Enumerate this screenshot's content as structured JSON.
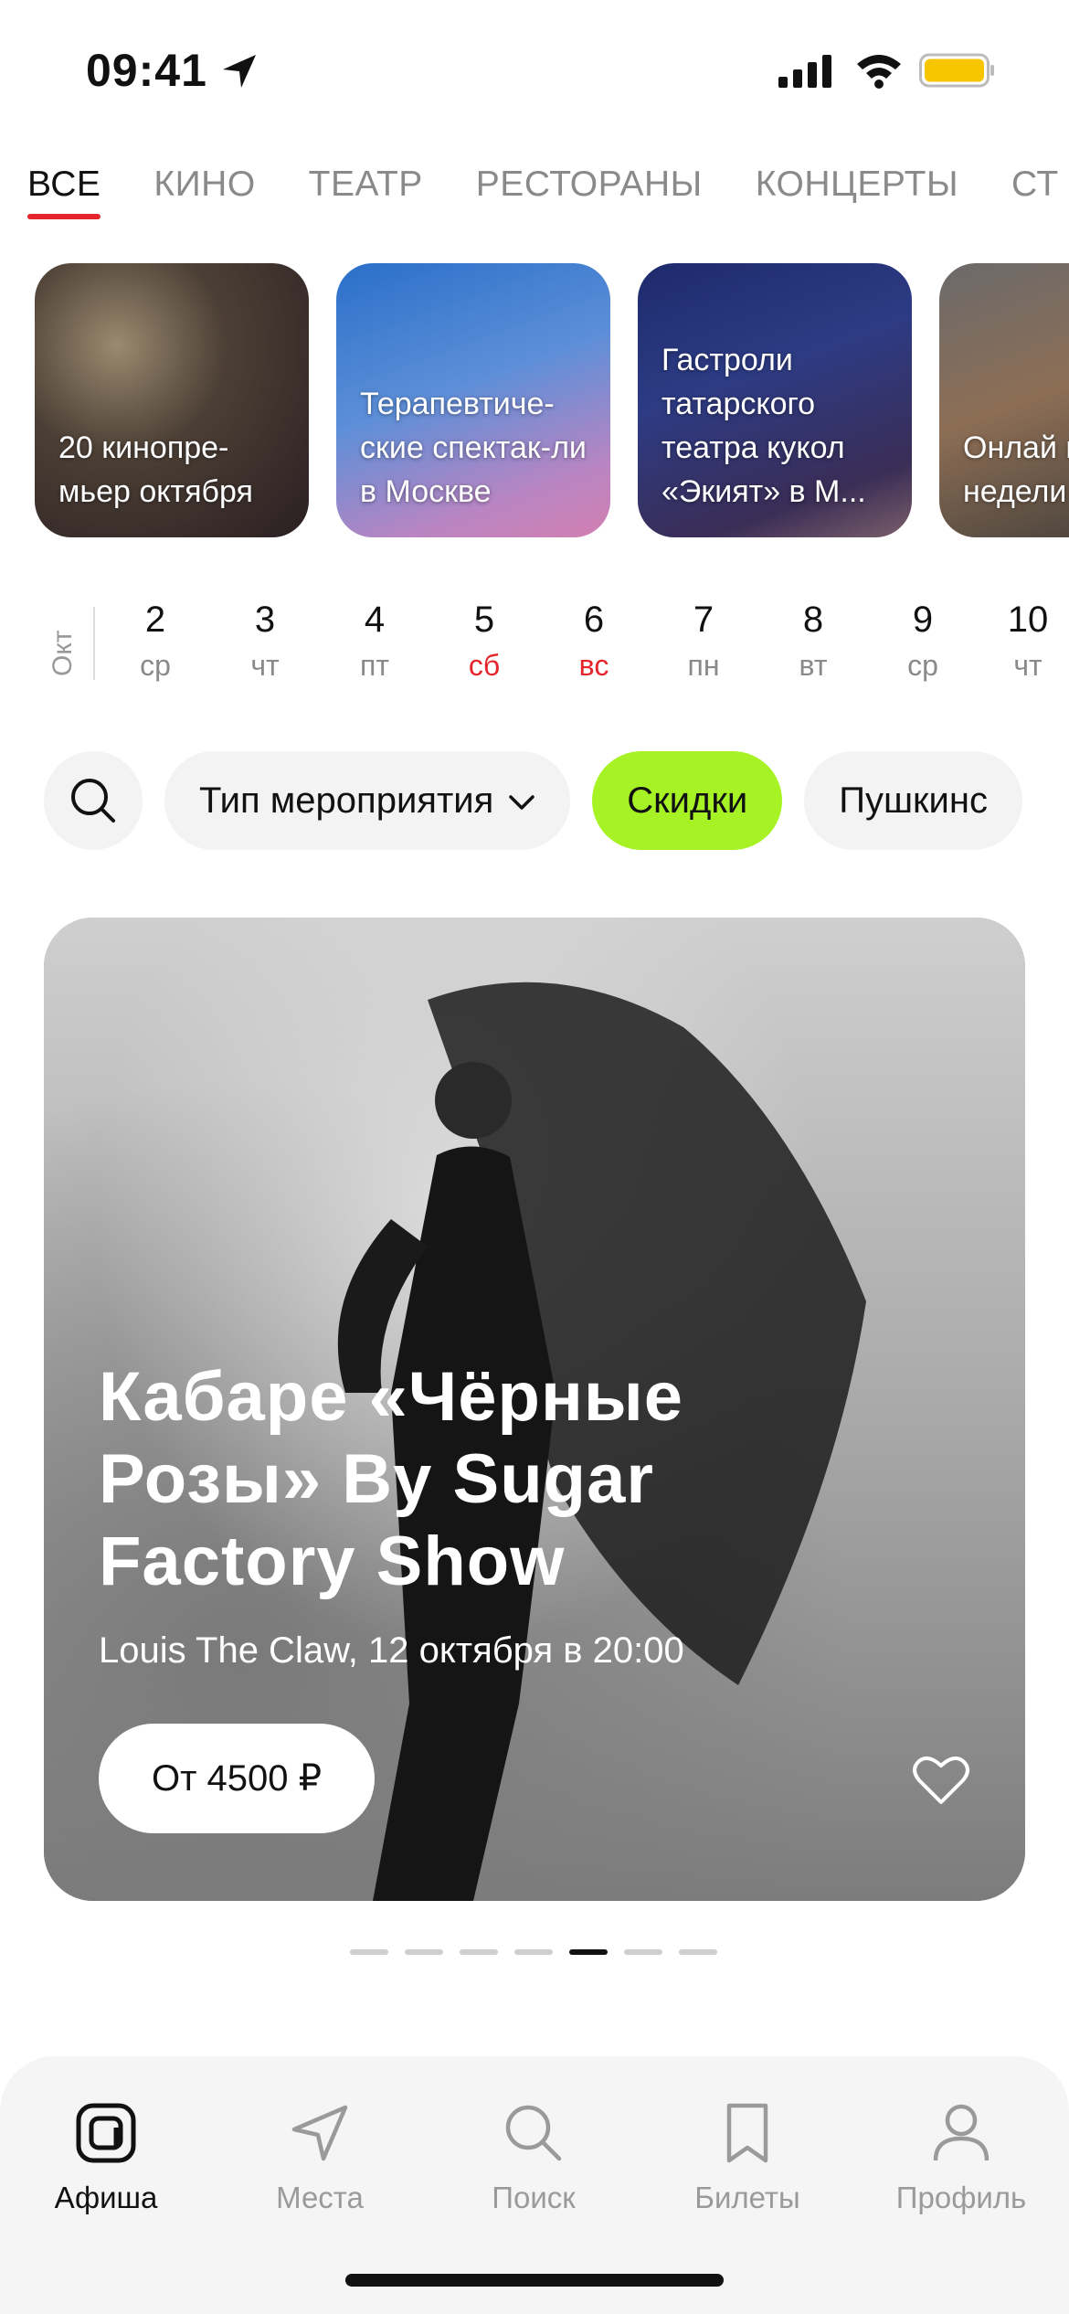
{
  "status_bar": {
    "time": "09:41",
    "icons": [
      "location-arrow-icon",
      "cellular-signal-icon",
      "wifi-icon",
      "battery-icon"
    ],
    "battery_color": "#f7c600"
  },
  "tabs": [
    "ВСЕ",
    "КИНО",
    "ТЕАТР",
    "РЕСТОРАНЫ",
    "КОНЦЕРТЫ",
    "СТ"
  ],
  "active_tab": "ВСЕ",
  "stories": [
    {
      "text": "20 кинопре-мьер октября"
    },
    {
      "text": "Терапевтиче-ские спектак-ли в Москве"
    },
    {
      "text": "Гастроли татарского театра кукол «Экият» в М..."
    },
    {
      "text": "Онлай премь недели"
    }
  ],
  "calendar": {
    "month": "Окт",
    "days": [
      {
        "num": "2",
        "wd": "ср",
        "weekend": false
      },
      {
        "num": "3",
        "wd": "чт",
        "weekend": false
      },
      {
        "num": "4",
        "wd": "пт",
        "weekend": false
      },
      {
        "num": "5",
        "wd": "сб",
        "weekend": true
      },
      {
        "num": "6",
        "wd": "вс",
        "weekend": true
      },
      {
        "num": "7",
        "wd": "пн",
        "weekend": false
      },
      {
        "num": "8",
        "wd": "вт",
        "weekend": false
      },
      {
        "num": "9",
        "wd": "ср",
        "weekend": false
      },
      {
        "num": "10",
        "wd": "чт",
        "weekend": false
      }
    ]
  },
  "filters": {
    "event_type": "Тип мероприятия",
    "discounts": "Скидки",
    "pushkin": "Пушкинс",
    "accent_color": "#a6f224"
  },
  "hero": {
    "title": "Кабаре «Чёрные Розы» By Sugar Factory Show",
    "subtitle": "Louis The Claw, 12 октября в 20:00",
    "price": "От 4500 ₽"
  },
  "pager": {
    "count": 7,
    "active_index": 4
  },
  "bottom_nav": [
    {
      "label": "Афиша",
      "icon": "afisha-logo-icon",
      "active": true
    },
    {
      "label": "Места",
      "icon": "navigation-arrow-icon",
      "active": false
    },
    {
      "label": "Поиск",
      "icon": "search-icon",
      "active": false
    },
    {
      "label": "Билеты",
      "icon": "ticket-icon",
      "active": false
    },
    {
      "label": "Профиль",
      "icon": "profile-icon",
      "active": false
    }
  ]
}
